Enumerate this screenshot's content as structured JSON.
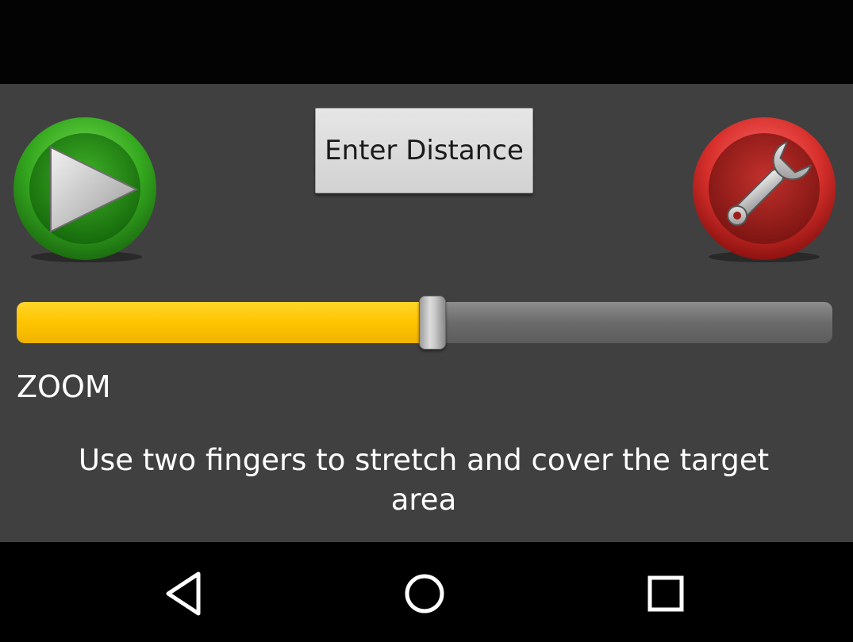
{
  "toolbar": {
    "enter_distance_label": "Enter Distance"
  },
  "zoom": {
    "label": "ZOOM",
    "level_fraction": 0.51
  },
  "instruction": {
    "text": "Use two fingers to stretch and cover the target area"
  },
  "icons": {
    "play": "play-icon",
    "settings": "wrench-icon",
    "back": "back-icon",
    "home": "home-icon",
    "recent": "recent-apps-icon"
  },
  "colors": {
    "play_button": "#2e9a1e",
    "settings_button": "#c9201f",
    "slider_fill": "#ffc400",
    "background": "#404040"
  }
}
